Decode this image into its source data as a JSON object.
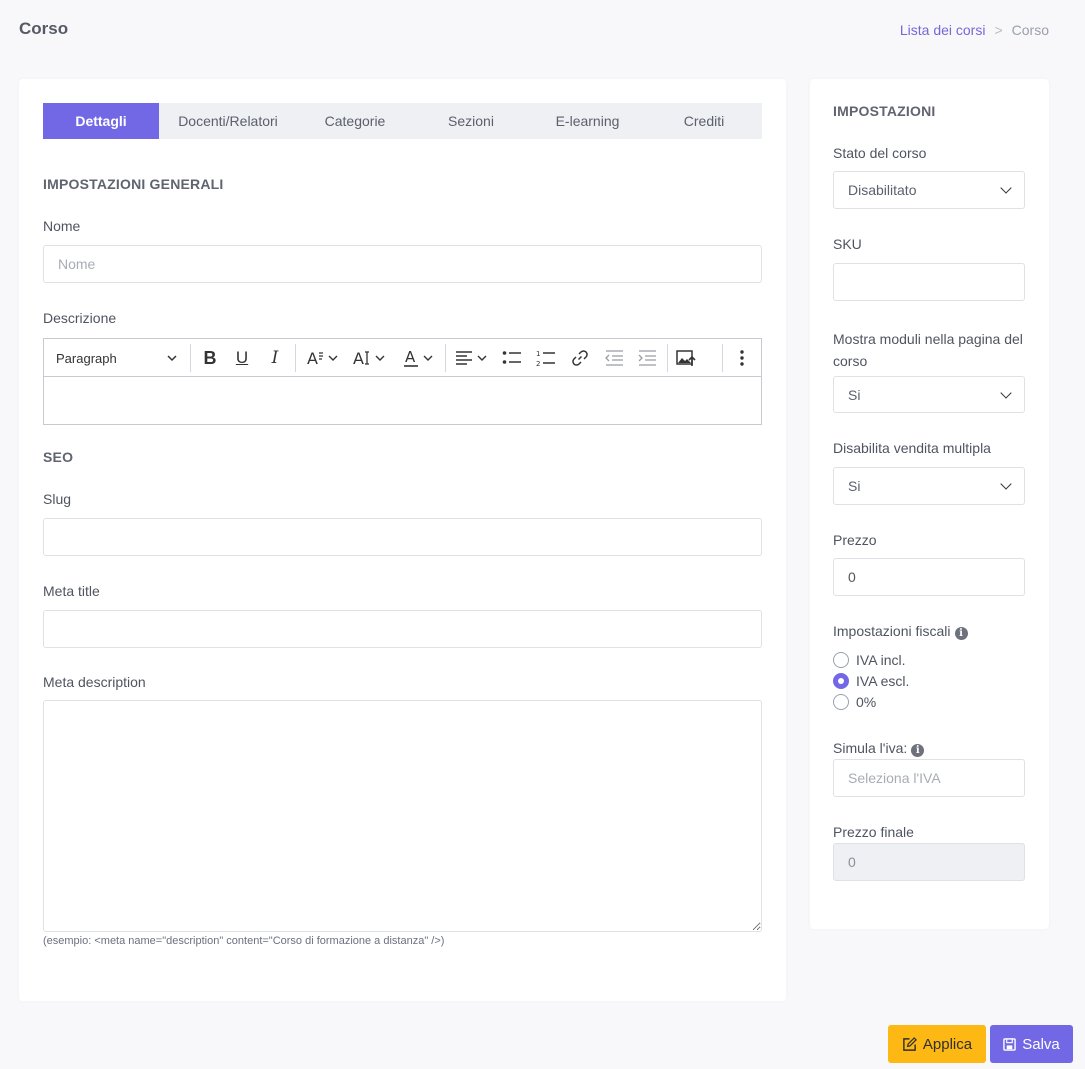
{
  "header": {
    "title": "Corso",
    "breadcrumb": {
      "link": "Lista dei corsi",
      "separator": ">",
      "current": "Corso"
    }
  },
  "tabs": [
    "Dettagli",
    "Docenti/Relatori",
    "Categorie",
    "Sezioni",
    "E-learning",
    "Crediti"
  ],
  "general": {
    "section_title": "IMPOSTAZIONI GENERALI",
    "name_label": "Nome",
    "name_placeholder": "Nome",
    "description_label": "Descrizione",
    "editor_paragraph": "Paragraph"
  },
  "seo": {
    "section_title": "SEO",
    "slug_label": "Slug",
    "meta_title_label": "Meta title",
    "meta_description_label": "Meta description",
    "hint": "(esempio: <meta name=\"description\" content=\"Corso di formazione a distanza\" />)"
  },
  "settings": {
    "title": "IMPOSTAZIONI",
    "status_label": "Stato del corso",
    "status_value": "Disabilitato",
    "sku_label": "SKU",
    "sku_value": "",
    "modules_label": "Mostra moduli nella pagina del corso",
    "modules_value": "Si",
    "multi_sale_label": "Disabilita vendita multipla",
    "multi_sale_value": "Si",
    "price_label": "Prezzo",
    "price_value": "0",
    "tax_label": "Impostazioni fiscali",
    "tax_options": [
      "IVA incl.",
      "IVA escl.",
      "0%"
    ],
    "tax_selected": "IVA escl.",
    "simulate_label": "Simula l'iva:",
    "simulate_placeholder": "Seleziona l'IVA",
    "final_price_label": "Prezzo finale",
    "final_price_value": "0"
  },
  "actions": {
    "apply": "Applica",
    "save": "Salva"
  },
  "colors": {
    "accent": "#7268e6",
    "apply": "#fdb813"
  }
}
